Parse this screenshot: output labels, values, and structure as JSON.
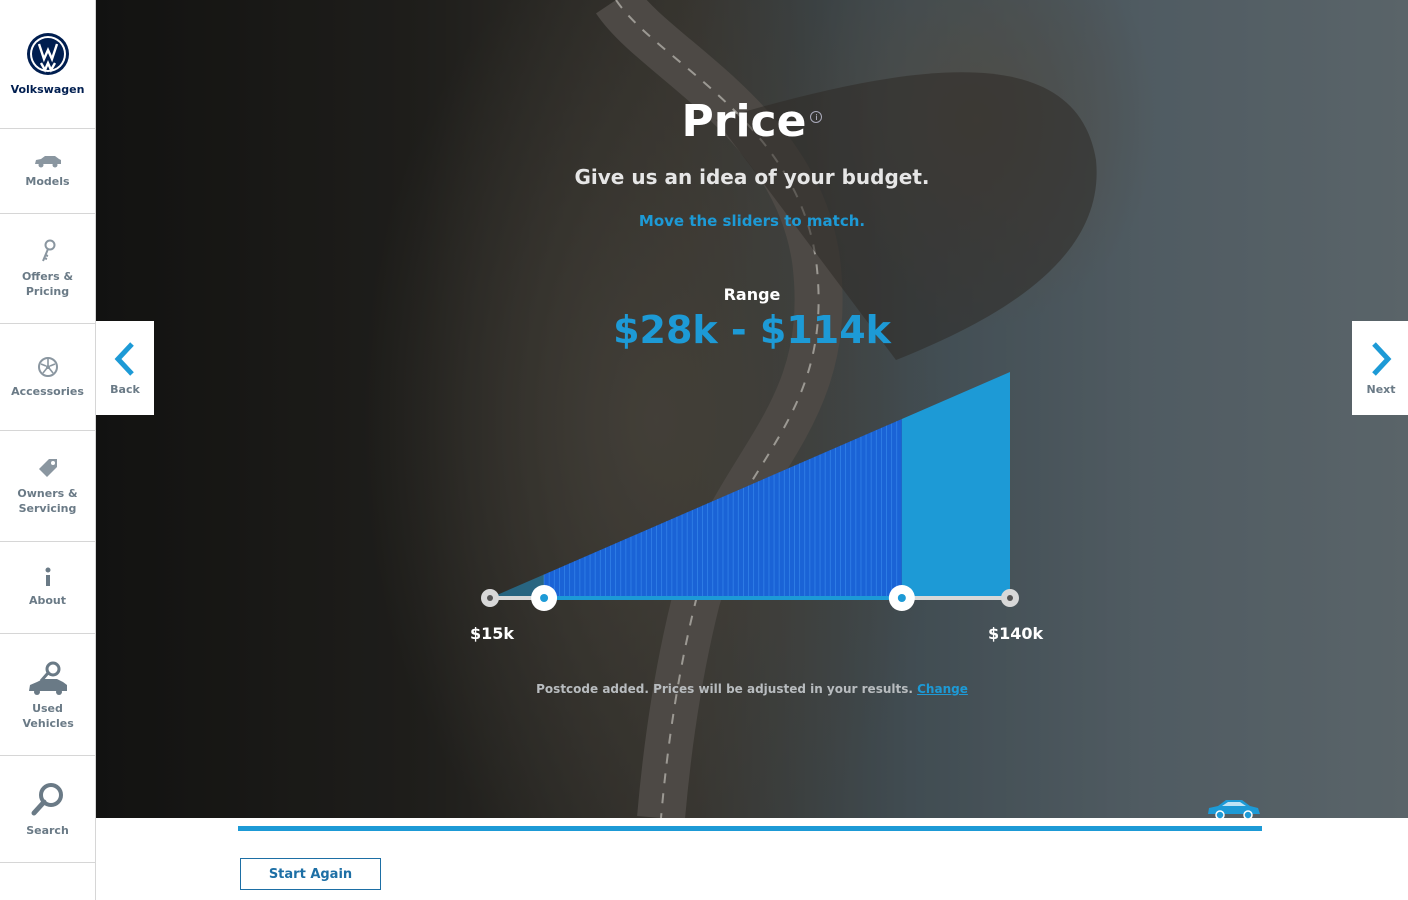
{
  "brand": {
    "name": "Volkswagen"
  },
  "sidebar": {
    "items": [
      {
        "label": "Models"
      },
      {
        "label": "Offers & Pricing"
      },
      {
        "label": "Accessories"
      },
      {
        "label": "Owners & Servicing"
      },
      {
        "label": "About"
      },
      {
        "label": "Used Vehicles"
      },
      {
        "label": "Search"
      }
    ]
  },
  "main": {
    "title": "Price",
    "subtitle": "Give us an idea of your budget.",
    "hint": "Move the sliders to match.",
    "range_label": "Range",
    "range_value": "$28k - $114k",
    "min_label": "$15k",
    "max_label": "$140k",
    "postcode_text": "Postcode added. Prices will be adjusted in your results.",
    "postcode_link": "Change"
  },
  "slider": {
    "min": 15,
    "max": 140,
    "low": 28,
    "high": 114,
    "unit": "k"
  },
  "nav": {
    "back_label": "Back",
    "next_label": "Next"
  },
  "footer": {
    "start_again_label": "Start Again",
    "progress": 1.0
  },
  "colors": {
    "accent": "#1d9ad6",
    "brand_navy": "#001e50"
  }
}
